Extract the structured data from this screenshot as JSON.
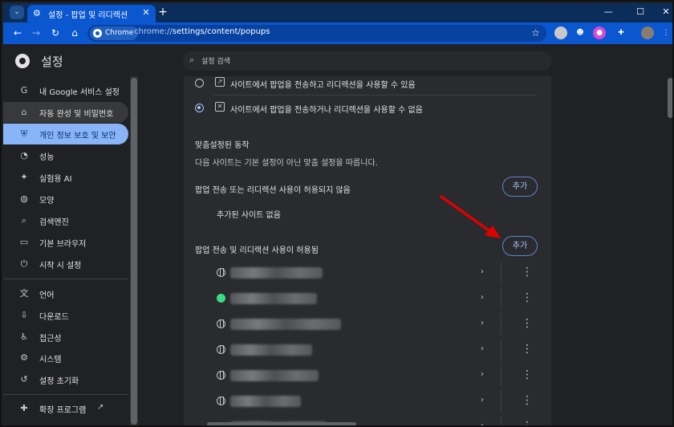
{
  "tab": {
    "title": "설정 - 팝업 및 리디렉션",
    "close_icon": "close-icon"
  },
  "toolbar": {
    "chip_label": "Chrome",
    "url_prefix": "chrome://",
    "url_path": "settings/content/popups"
  },
  "settings": {
    "title": "설정",
    "search_placeholder": "설정 검색"
  },
  "sidebar": {
    "items": [
      {
        "label": "내 Google 서비스 설정",
        "icon": "G"
      },
      {
        "label": "자동 완성 및 비밀번호",
        "icon": "⌂"
      },
      {
        "label": "개인 정보 보호 및 보안",
        "icon": "⛨"
      },
      {
        "label": "성능",
        "icon": "◔"
      },
      {
        "label": "실험용 AI",
        "icon": "✦"
      },
      {
        "label": "모양",
        "icon": "◍"
      },
      {
        "label": "검색엔진",
        "icon": "⌕"
      },
      {
        "label": "기본 브라우저",
        "icon": "▭"
      },
      {
        "label": "시작 시 설정",
        "icon": "⏻"
      },
      {
        "label": "언어",
        "icon": "文"
      },
      {
        "label": "다운로드",
        "icon": "⇩"
      },
      {
        "label": "접근성",
        "icon": "♿"
      },
      {
        "label": "시스템",
        "icon": "⚙"
      },
      {
        "label": "설정 초기화",
        "icon": "↺"
      },
      {
        "label": "확장 프로그램",
        "icon": "✚"
      }
    ]
  },
  "popups": {
    "option_allow": "사이트에서 팝업을 전송하고 리디렉션을 사용할 수 있음",
    "option_block": "사이트에서 팝업을 전송하거나 리디렉션을 사용할 수 없음",
    "custom_heading": "맞춤설정된 동작",
    "custom_desc": "다음 사이트는 기본 설정이 아닌 맞춤 설정을 따릅니다.",
    "blocked_label": "팝업 전송 또는 리디렉션 사용이 허용되지 않음",
    "no_sites": "추가된 사이트 없음",
    "allowed_label": "팝업 전송 및 리디렉션 사용이 허용됨",
    "add_label": "추가"
  },
  "colors": {
    "accent": "#0b57d0",
    "active_nav": "#89b4f8",
    "arrow": "#e00000"
  }
}
